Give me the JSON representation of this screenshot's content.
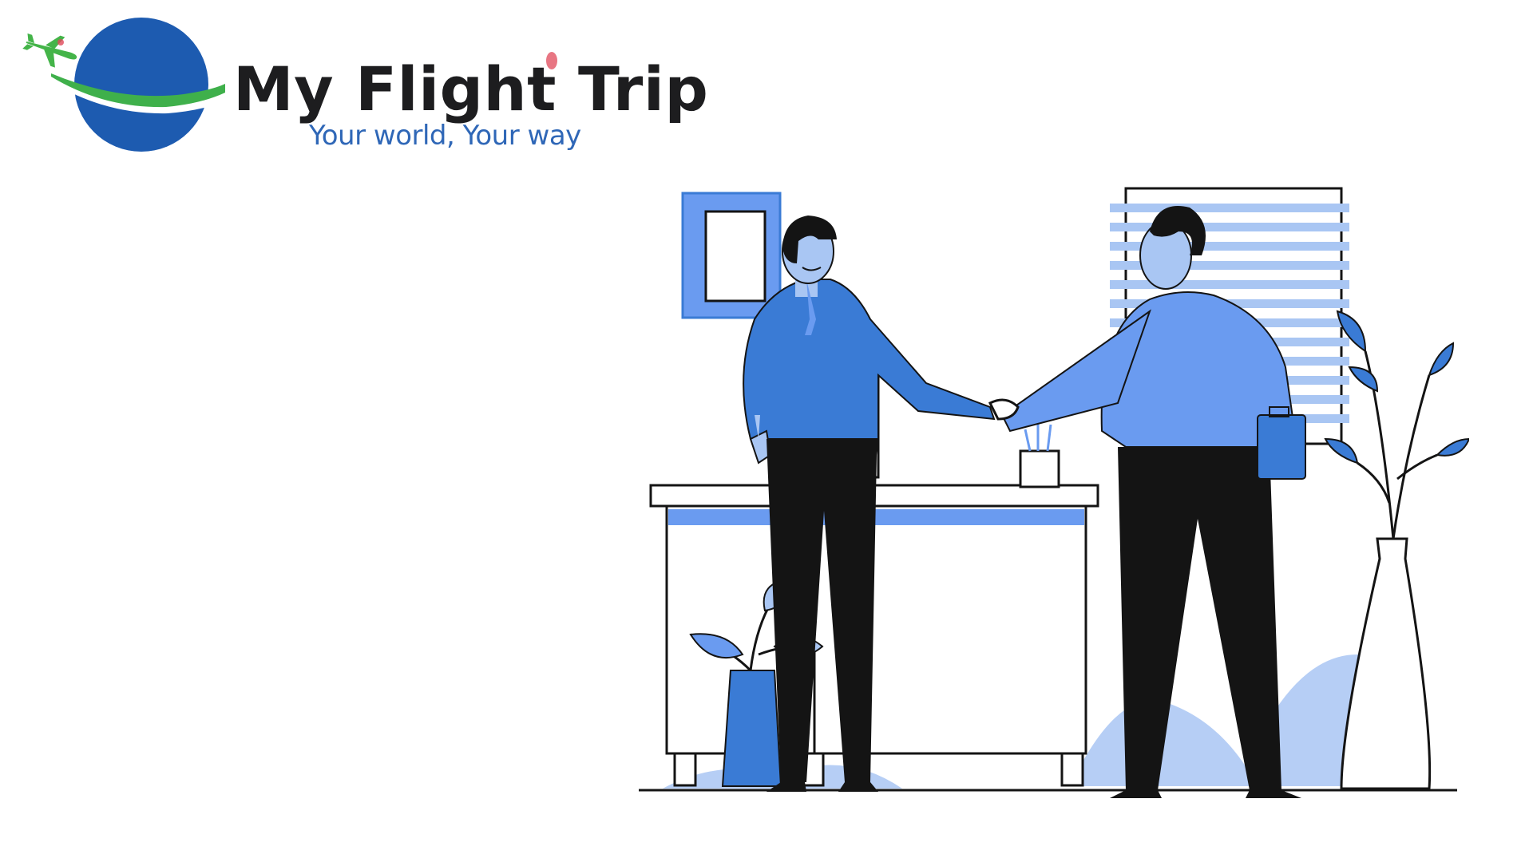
{
  "brand": {
    "name": "My Flight Trip",
    "tagline": "Your world, Your way"
  },
  "colors": {
    "primary_blue": "#3a7bd5",
    "light_blue": "#a9c6f3",
    "mid_blue": "#6a9bf0",
    "logo_globe": "#1d5bb0",
    "logo_swoosh": "#3fb04b",
    "logo_plane": "#44b449",
    "pant_black": "#141414"
  },
  "icons": {
    "logo_globe": "globe-icon",
    "logo_plane": "airplane-icon"
  }
}
